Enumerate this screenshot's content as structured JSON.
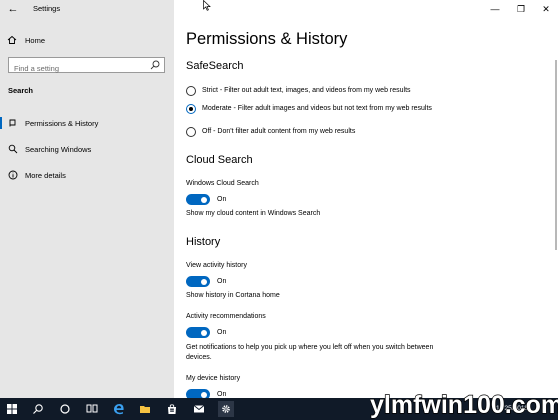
{
  "window": {
    "app_title": "Settings",
    "controls": {
      "minimize": "—",
      "maximize": "❐",
      "close": "✕"
    }
  },
  "sidebar": {
    "home_label": "Home",
    "search_placeholder": "Find a setting",
    "section_label": "Search",
    "items": [
      {
        "label": "Permissions & History",
        "icon": "permissions-icon",
        "active": true
      },
      {
        "label": "Searching Windows",
        "icon": "search-icon",
        "active": false
      },
      {
        "label": "More details",
        "icon": "info-icon",
        "active": false
      }
    ]
  },
  "main": {
    "title": "Permissions & History",
    "safesearch": {
      "heading": "SafeSearch",
      "options": [
        {
          "label": "Strict - Filter out adult text, images, and videos from my web results",
          "checked": false
        },
        {
          "label": "Moderate - Filter adult images and videos but not text from my web results",
          "checked": true
        },
        {
          "label": "Off - Don't filter adult content from my web results",
          "checked": false
        }
      ]
    },
    "cloud_search": {
      "heading": "Cloud Search",
      "setting_label": "Windows Cloud Search",
      "state": "On",
      "description": "Show my cloud content in Windows Search"
    },
    "history": {
      "heading": "History",
      "activity_label": "View activity history",
      "activity_state": "On",
      "activity_description": "Show history in Cortana home",
      "recommendations_label": "Activity recommendations",
      "recommendations_state": "On",
      "recommendations_description": "Get notifications to help you pick up where you left off when you switch between devices.",
      "device_label": "My device history",
      "device_state": "On"
    }
  },
  "taskbar": {
    "date": "11/25/2018",
    "icons": [
      "windows-start-icon",
      "search-icon",
      "cortana-icon",
      "task-view-icon",
      "edge-icon",
      "file-explorer-icon",
      "store-icon",
      "mail-icon",
      "settings-icon"
    ]
  },
  "watermark": {
    "text": "ylmfwin100.com"
  },
  "colors": {
    "accent": "#0067c0",
    "sidebar_bg": "#e6e6e6",
    "taskbar_bg": "#101a28"
  }
}
